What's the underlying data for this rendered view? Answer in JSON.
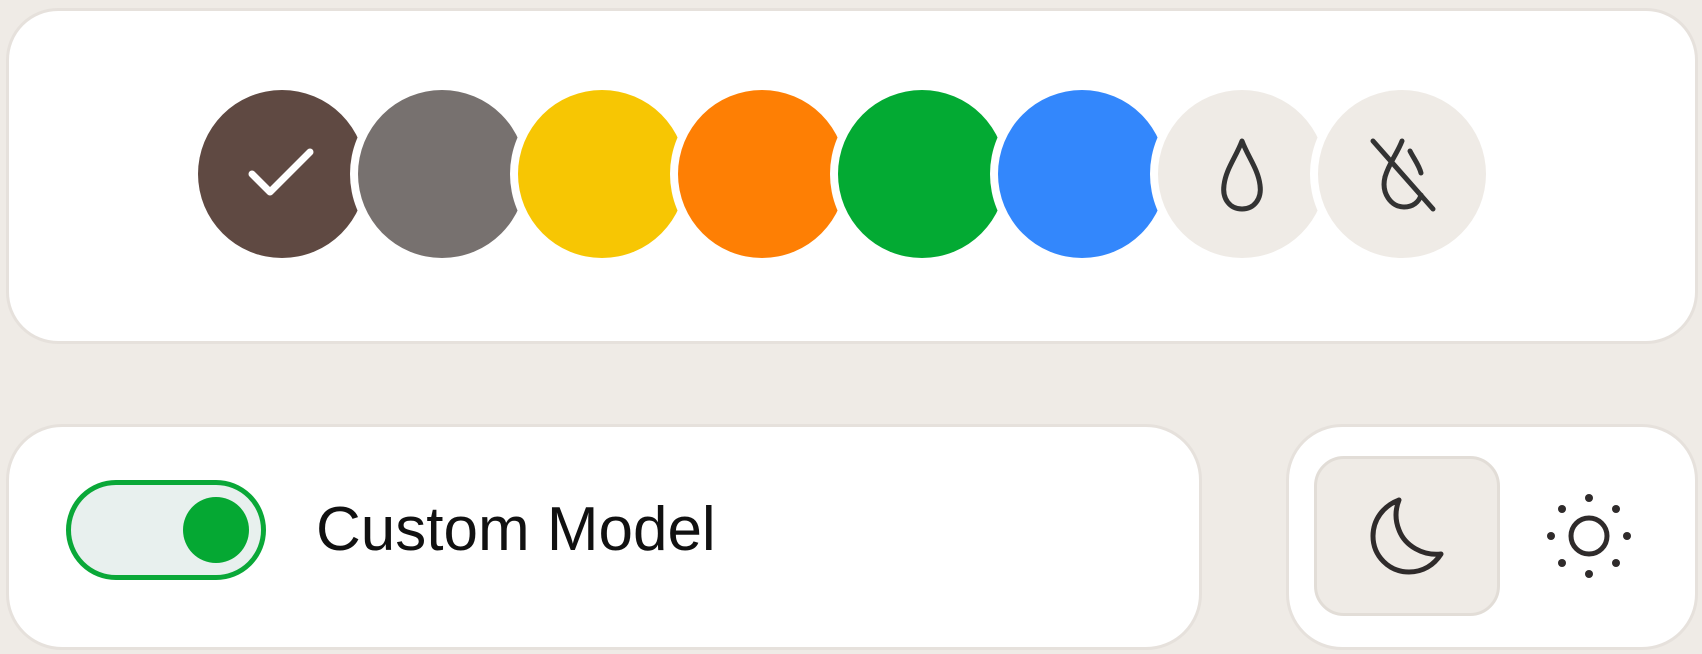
{
  "palette": {
    "swatches": [
      {
        "name": "brown",
        "color": "#5f4942",
        "selected": true,
        "icon": "check-icon"
      },
      {
        "name": "gray",
        "color": "#77716f",
        "selected": false
      },
      {
        "name": "yellow",
        "color": "#f7c603",
        "selected": false
      },
      {
        "name": "orange",
        "color": "#fe7f04",
        "selected": false
      },
      {
        "name": "green",
        "color": "#03aa33",
        "selected": false
      },
      {
        "name": "blue",
        "color": "#3387fc",
        "selected": false
      },
      {
        "name": "custom-color",
        "color": "#efebe6",
        "selected": false,
        "icon": "droplet-icon"
      },
      {
        "name": "no-color",
        "color": "#efebe6",
        "selected": false,
        "icon": "droplet-off-icon"
      }
    ]
  },
  "model": {
    "toggle_on": true,
    "accent": "#05a833",
    "label": "Custom Model"
  },
  "theme": {
    "options": [
      {
        "name": "dark",
        "icon": "moon-icon",
        "selected": true
      },
      {
        "name": "light",
        "icon": "sun-icon",
        "selected": false
      }
    ]
  }
}
